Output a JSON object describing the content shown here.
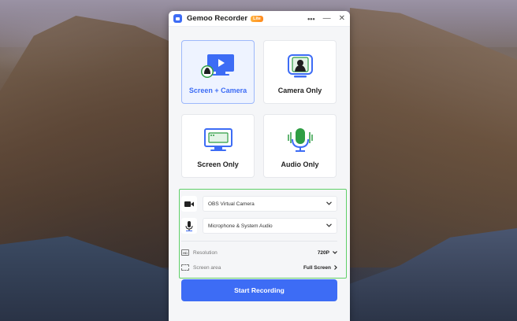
{
  "app": {
    "title": "Gemoo Recorder",
    "badge": "Lite",
    "controls": {
      "more": "•••",
      "minimize": "—",
      "close": "✕"
    }
  },
  "modes": [
    {
      "label": "Screen + Camera",
      "icon": "screen-camera-icon",
      "active": true
    },
    {
      "label": "Camera Only",
      "icon": "camera-icon",
      "active": false
    },
    {
      "label": "Screen Only",
      "icon": "screen-icon",
      "active": false
    },
    {
      "label": "Audio Only",
      "icon": "microphone-icon",
      "active": false
    }
  ],
  "devices": {
    "camera": {
      "value": "OBS Virtual Camera",
      "icon": "video-camera-icon"
    },
    "audio": {
      "value": "Microphone & System Audio",
      "icon": "microphone-icon"
    }
  },
  "options": {
    "resolution": {
      "label": "Resolution",
      "value": "720P",
      "icon": "hd-icon"
    },
    "screen_area": {
      "label": "Screen area",
      "value": "Full Screen",
      "icon": "area-select-icon"
    }
  },
  "start_button": "Start Recording",
  "colors": {
    "accent": "#3d6cf5",
    "highlight_border": "#5fd068",
    "badge": "#ff9a2a",
    "active_card_bg": "#eef3ff"
  }
}
